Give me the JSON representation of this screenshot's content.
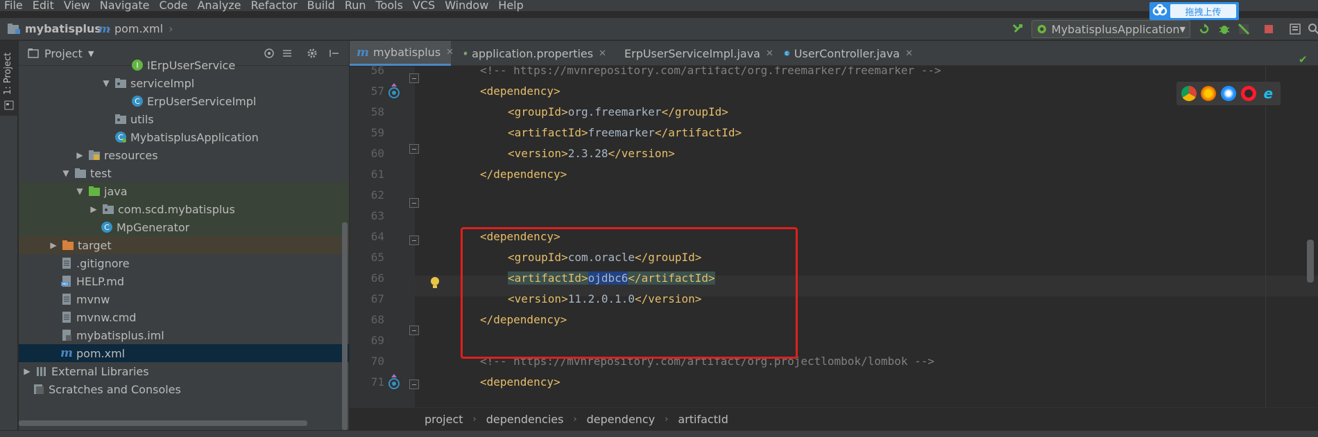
{
  "menu": [
    "File",
    "Edit",
    "View",
    "Navigate",
    "Code",
    "Analyze",
    "Refactor",
    "Build",
    "Run",
    "Tools",
    "VCS",
    "Window",
    "Help"
  ],
  "nav": {
    "project": "mybatisplus",
    "file": "pom.xml"
  },
  "run_config": {
    "name": "MybatisplusApplication"
  },
  "upload_badge": {
    "label": "拖拽上传"
  },
  "left_strip": {
    "label": "1: Project"
  },
  "project_panel": {
    "title": "Project",
    "rows": [
      {
        "label": "IErpUserService"
      },
      {
        "label": "serviceImpl"
      },
      {
        "label": "ErpUserServiceImpl"
      },
      {
        "label": "utils"
      },
      {
        "label": "MybatisplusApplication"
      },
      {
        "label": "resources"
      },
      {
        "label": "test"
      },
      {
        "label": "java"
      },
      {
        "label": "com.scd.mybatisplus"
      },
      {
        "label": "MpGenerator"
      },
      {
        "label": "target"
      },
      {
        "label": ".gitignore"
      },
      {
        "label": "HELP.md"
      },
      {
        "label": "mvnw"
      },
      {
        "label": "mvnw.cmd"
      },
      {
        "label": "mybatisplus.iml"
      },
      {
        "label": "pom.xml"
      },
      {
        "label": "External Libraries"
      },
      {
        "label": "Scratches and Consoles"
      }
    ]
  },
  "tabs": [
    {
      "label": "mybatisplus"
    },
    {
      "label": "application.properties"
    },
    {
      "label": "ErpUserServiceImpl.java"
    },
    {
      "label": "UserController.java"
    }
  ],
  "editor": {
    "line_numbers": [
      "56",
      "57",
      "58",
      "59",
      "60",
      "61",
      "62",
      "63",
      "64",
      "65",
      "66",
      "67",
      "68",
      "69",
      "70",
      "71"
    ],
    "comment_freemarker": "<!-- https://mvnrepository.com/artifact/org.freemarker/freemarker -->",
    "dependency_open": "<dependency>",
    "dependency_close": "</dependency>",
    "freemarker_groupId": "org.freemarker",
    "freemarker_artifactId": "freemarker",
    "freemarker_version": "2.3.28",
    "oracle_groupId": "com.oracle",
    "oracle_artifactId": "ojdbc6",
    "oracle_version": "11.2.0.1.0",
    "comment_lombok": "<!-- https://mvnrepository.com/artifact/org.projectlombok/lombok -->",
    "tag_groupId_open": "<groupId>",
    "tag_groupId_close": "</groupId>",
    "tag_artifactId_open": "<artifactId>",
    "tag_artifactId_close": "</artifactId>",
    "tag_version_open": "<version>",
    "tag_version_close": "</version>"
  },
  "breadcrumb": [
    "project",
    "dependencies",
    "dependency",
    "artifactId"
  ],
  "colors": {
    "highlight_box": "#e0201b",
    "selection": "#214283",
    "tag": "#e8bf6a"
  }
}
